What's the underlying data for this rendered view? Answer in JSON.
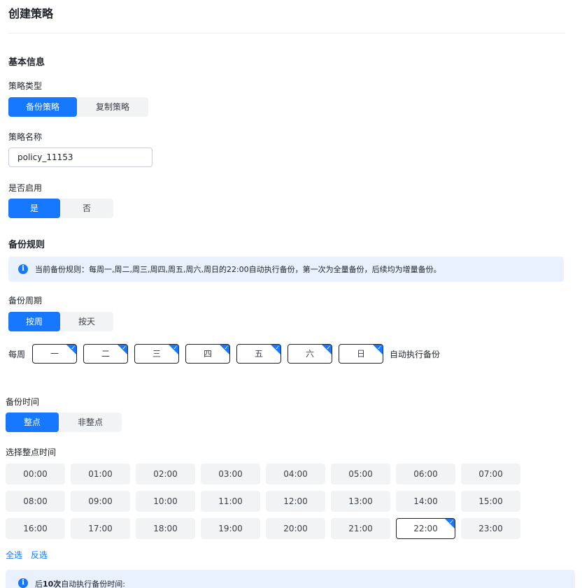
{
  "page": {
    "title": "创建策略"
  },
  "basic": {
    "section_title": "基本信息",
    "type_label": "策略类型",
    "type_options": [
      "备份策略",
      "复制策略"
    ],
    "name_label": "策略名称",
    "name_value": "policy_11153",
    "enable_label": "是否启用",
    "enable_options": [
      "是",
      "否"
    ]
  },
  "rules": {
    "section_title": "备份规则",
    "info_text": "当前备份规则：每周一,周二,周三,周四,周五,周六,周日的22:00自动执行备份，第一次为全量备份，后续均为增量备份。",
    "cycle_label": "备份周期",
    "cycle_options": [
      "按周",
      "按天"
    ],
    "week_prefix": "每周",
    "weekdays": [
      "一",
      "二",
      "三",
      "四",
      "五",
      "六",
      "日"
    ],
    "week_suffix": "自动执行备份",
    "time_label": "备份时间",
    "time_options": [
      "整点",
      "非整点"
    ],
    "hour_label": "选择整点时间",
    "hours": [
      "00:00",
      "01:00",
      "02:00",
      "03:00",
      "04:00",
      "05:00",
      "06:00",
      "07:00",
      "08:00",
      "09:00",
      "10:00",
      "11:00",
      "12:00",
      "13:00",
      "14:00",
      "15:00",
      "16:00",
      "17:00",
      "18:00",
      "19:00",
      "20:00",
      "21:00",
      "22:00",
      "23:00"
    ],
    "selected_hour": "22:00",
    "select_all": "全选",
    "invert_select": "反选",
    "next_prefix": "后",
    "next_count": "10次",
    "next_suffix": "自动执行备份时间:"
  },
  "colors": {
    "accent": "#1677ff",
    "info_bg": "#e8f1fd",
    "option_bg": "#f2f3f5"
  },
  "icons": {
    "info": "info-icon",
    "check": "check-corner-icon"
  }
}
